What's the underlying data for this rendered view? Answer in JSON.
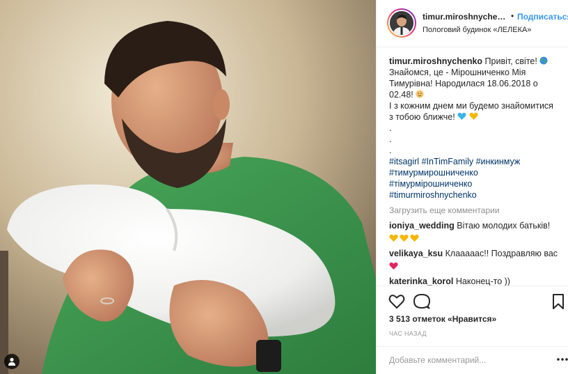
{
  "header": {
    "username": "timur.miroshnychen...",
    "dot": "•",
    "follow_label": "Подписаться",
    "location": "Пологовий будинок «ЛЕЛЕКА»"
  },
  "caption": {
    "username": "timur.miroshnychenko",
    "line1": "Привіт, світе!",
    "line2": "Знайомся, це - Мірошниченко Мія",
    "line3": "Тимурівна! Народилася 18.06.2018 о",
    "line4": "02.48!",
    "line5": "І з кожним днем ми будемо знайомитися",
    "line6": "з тобою ближче!",
    "dot1": ".",
    "dot2": ".",
    "dot3": ".",
    "tag1": "#itsagirl",
    "tag2": "#InTimFamily",
    "tag3": "#инкинмуж",
    "tag4": "#тимурмирошниченко",
    "tag5": "#тімурмірошниченко",
    "tag6": "#timurmiroshnychenko"
  },
  "load_more": "Загрузить еще комментарии",
  "comments": [
    {
      "user": "ioniya_wedding",
      "text": "Вітаю молодих батьків!"
    },
    {
      "user": "velikaya_ksu",
      "text": "Клааааас!! Поздравляю вас"
    },
    {
      "user": "katerinka_korol",
      "text": "Наконец-то ))"
    }
  ],
  "likes": "3 513 отметок «Нравится»",
  "time": "час назад",
  "add_comment_placeholder": "Добавьте комментарий...",
  "icons": {
    "tag": "user-tag-icon",
    "like": "heart-icon",
    "comment": "comment-bubble-icon",
    "save": "bookmark-icon",
    "options": "more-options-icon"
  },
  "colors": {
    "link_blue": "#3897f0",
    "hashtag": "#003569",
    "muted": "#8e8e8e"
  }
}
